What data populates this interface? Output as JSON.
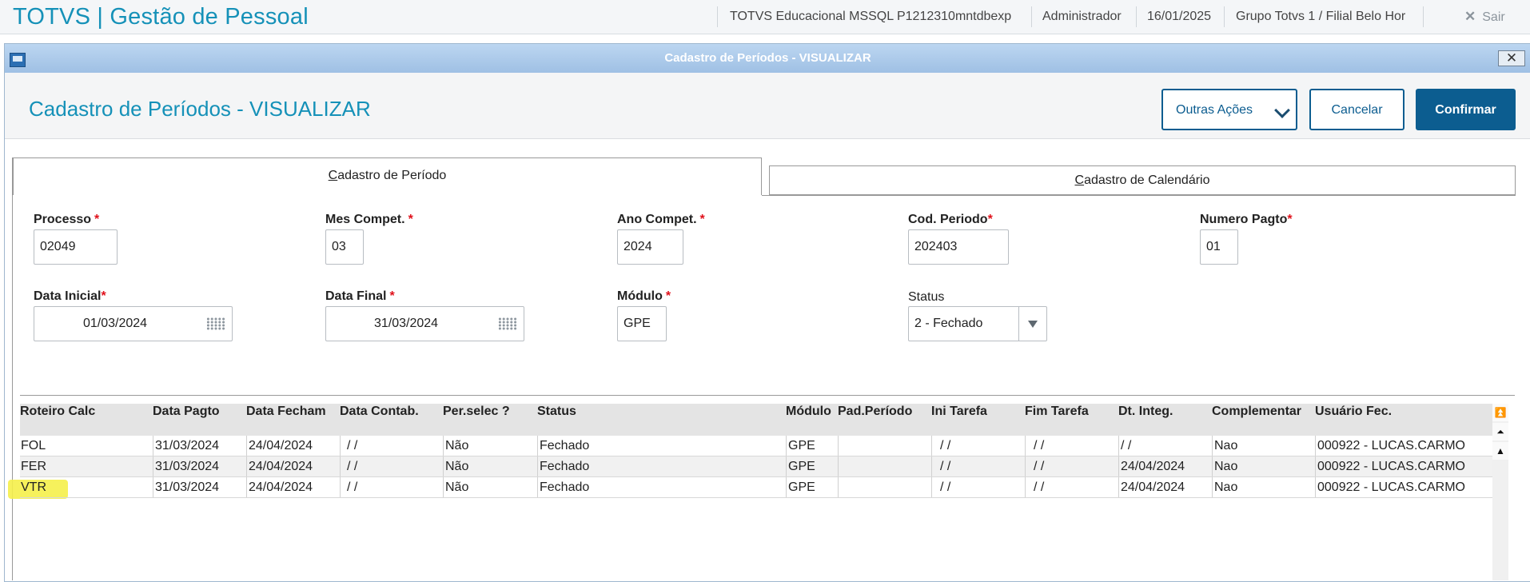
{
  "header": {
    "app_title": "TOTVS | Gestão de Pessoal",
    "environment": "TOTVS Educacional MSSQL P1212310mntdbexp",
    "user": "Administrador",
    "date": "16/01/2025",
    "branch": "Grupo Totvs 1 / Filial Belo Hor",
    "exit_label": "Sair"
  },
  "dialog": {
    "window_title": "Cadastro de Períodos - VISUALIZAR",
    "heading": "Cadastro de Períodos - VISUALIZAR",
    "close_glyph": "✕",
    "buttons": {
      "other_actions": "Outras Ações",
      "cancel": "Cancelar",
      "confirm": "Confirmar"
    },
    "tabs": {
      "period": {
        "accel": "C",
        "rest": "adastro de Período"
      },
      "calendar": {
        "accel": "C",
        "rest": "adastro de Calendário"
      }
    }
  },
  "form": {
    "processo": {
      "label": "Processo",
      "value": "02049"
    },
    "mes_compet": {
      "label": "Mes Compet.",
      "value": "03"
    },
    "ano_compet": {
      "label": "Ano Compet.",
      "value": "2024"
    },
    "cod_periodo": {
      "label": "Cod. Periodo",
      "value": "202403"
    },
    "numero_pagto": {
      "label": "Numero Pagto",
      "value": "01"
    },
    "data_inicial": {
      "label": "Data Inicial",
      "value": "01/03/2024"
    },
    "data_final": {
      "label": "Data Final",
      "value": "31/03/2024"
    },
    "modulo": {
      "label": "Módulo",
      "value": "GPE"
    },
    "status": {
      "label": "Status",
      "value": "2 - Fechado"
    },
    "required_mark": "*"
  },
  "grid": {
    "columns": [
      "Roteiro Calc",
      "Data Pagto",
      "Data Fecham",
      "Data Contab.",
      "Per.selec ?",
      "Status",
      "Módulo",
      "Pad.Período",
      "Ini Tarefa",
      "Fim Tarefa",
      "Dt. Integ.",
      "Complementar",
      "Usuário Fec."
    ],
    "rows": [
      [
        "FOL",
        "31/03/2024",
        "24/04/2024",
        "  /  /",
        "Não",
        "Fechado",
        "GPE",
        "",
        "  /  /",
        "  /  /",
        "  /  /",
        "Nao",
        "000922 - LUCAS.CARMO"
      ],
      [
        "FER",
        "31/03/2024",
        "24/04/2024",
        "  /  /",
        "Não",
        "Fechado",
        "GPE",
        "",
        "  /  /",
        "  /  /",
        "24/04/2024",
        "Nao",
        "000922 - LUCAS.CARMO"
      ],
      [
        "VTR",
        "31/03/2024",
        "24/04/2024",
        "  /  /",
        "Não",
        "Fechado",
        "GPE",
        "",
        "  /  /",
        "  /  /",
        "24/04/2024",
        "Nao",
        "000922 - LUCAS.CARMO"
      ]
    ],
    "highlighted_row_value": "VTR",
    "highlight_color": "#f5f04a"
  },
  "colors": {
    "brand": "#1591b8",
    "primary_button": "#0c5d90",
    "required": "#e0101a"
  },
  "icons": {
    "exit": "close-icon",
    "calendar": "calendar-icon",
    "dropdown": "chevron-down-icon",
    "scroll_top": "scroll-top-icon",
    "scroll_page_up": "scroll-page-up-icon",
    "scroll_up": "scroll-up-icon"
  }
}
